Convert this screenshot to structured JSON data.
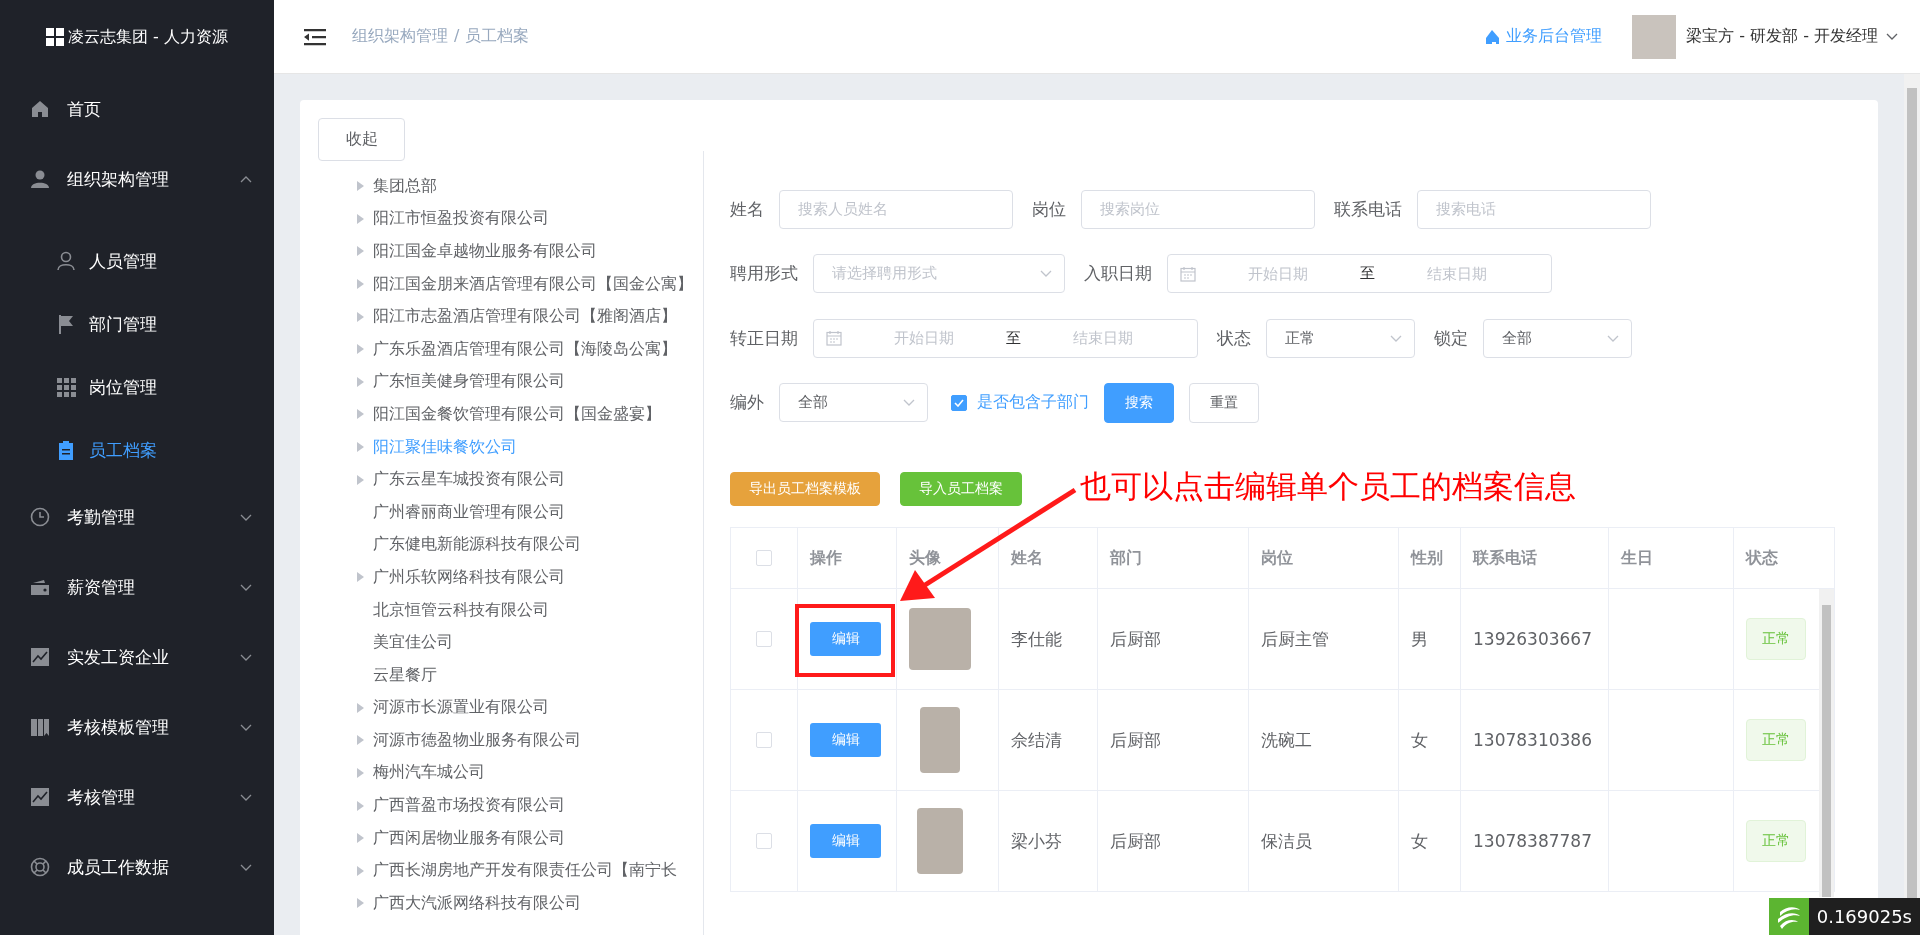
{
  "app": {
    "logo_title": "凌云志集团 - 人力资源"
  },
  "sidebar": {
    "items": [
      {
        "label": "首页"
      },
      {
        "label": "组织架构管理",
        "expanded": true,
        "children": [
          {
            "label": "人员管理",
            "selected": false
          },
          {
            "label": "部门管理",
            "selected": false
          },
          {
            "label": "岗位管理",
            "selected": false
          },
          {
            "label": "员工档案",
            "selected": true
          }
        ]
      },
      {
        "label": "考勤管理",
        "expanded": false
      },
      {
        "label": "薪资管理",
        "expanded": false
      },
      {
        "label": "实发工资企业",
        "expanded": false
      },
      {
        "label": "考核模板管理",
        "expanded": false
      },
      {
        "label": "考核管理",
        "expanded": false
      },
      {
        "label": "成员工作数据",
        "expanded": false
      }
    ]
  },
  "header": {
    "breadcrumb": [
      "组织架构管理",
      "员工档案"
    ],
    "breadcrumb_separator": "/",
    "home_link": "业务后台管理",
    "user": "梁宝方 - 研发部 - 开发经理"
  },
  "tree": {
    "collapse_button": "收起",
    "items": [
      {
        "label": "集团总部",
        "has_children": true,
        "selected": false
      },
      {
        "label": "阳江市恒盈投资有限公司",
        "has_children": true,
        "selected": false
      },
      {
        "label": "阳江国金卓越物业服务有限公司",
        "has_children": true,
        "selected": false
      },
      {
        "label": "阳江国金朋来酒店管理有限公司【国金公寓】",
        "has_children": true,
        "selected": false
      },
      {
        "label": "阳江市志盈酒店管理有限公司【雅阁酒店】",
        "has_children": true,
        "selected": false
      },
      {
        "label": "广东乐盈酒店管理有限公司【海陵岛公寓】",
        "has_children": true,
        "selected": false
      },
      {
        "label": "广东恒美健身管理有限公司",
        "has_children": true,
        "selected": false
      },
      {
        "label": "阳江国金餐饮管理有限公司【国金盛宴】",
        "has_children": true,
        "selected": false
      },
      {
        "label": "阳江聚佳味餐饮公司",
        "has_children": true,
        "selected": true
      },
      {
        "label": "广东云星车城投资有限公司",
        "has_children": true,
        "selected": false
      },
      {
        "label": "广州睿丽商业管理有限公司",
        "has_children": false,
        "selected": false
      },
      {
        "label": "广东健电新能源科技有限公司",
        "has_children": false,
        "selected": false
      },
      {
        "label": "广州乐软网络科技有限公司",
        "has_children": true,
        "selected": false
      },
      {
        "label": "北京恒管云科技有限公司",
        "has_children": false,
        "selected": false
      },
      {
        "label": "美宜佳公司",
        "has_children": false,
        "selected": false
      },
      {
        "label": "云星餐厅",
        "has_children": false,
        "selected": false
      },
      {
        "label": "河源市长源置业有限公司",
        "has_children": true,
        "selected": false
      },
      {
        "label": "河源市德盈物业服务有限公司",
        "has_children": true,
        "selected": false
      },
      {
        "label": "梅州汽车城公司",
        "has_children": true,
        "selected": false
      },
      {
        "label": "广西普盈市场投资有限公司",
        "has_children": true,
        "selected": false
      },
      {
        "label": "广西闲居物业服务有限公司",
        "has_children": true,
        "selected": false
      },
      {
        "label": "广西长湖房地产开发有限责任公司【南宁长",
        "has_children": true,
        "selected": false
      },
      {
        "label": "广西大汽派网络科技有限公司",
        "has_children": true,
        "selected": false
      }
    ]
  },
  "filters": {
    "rows": [
      {
        "fields": [
          {
            "kind": "text",
            "label": "姓名",
            "placeholder": "搜索人员姓名"
          },
          {
            "kind": "text",
            "label": "岗位",
            "placeholder": "搜索岗位"
          },
          {
            "kind": "text",
            "label": "联系电话",
            "placeholder": "搜索电话"
          }
        ]
      },
      {
        "fields": [
          {
            "kind": "select",
            "label": "聘用形式",
            "placeholder": "请选择聘用形式"
          },
          {
            "kind": "daterange",
            "label": "入职日期",
            "start_placeholder": "开始日期",
            "separator": "至",
            "end_placeholder": "结束日期"
          }
        ]
      },
      {
        "fields": [
          {
            "kind": "daterange",
            "label": "转正日期",
            "start_placeholder": "开始日期",
            "separator": "至",
            "end_placeholder": "结束日期"
          },
          {
            "kind": "select",
            "label": "状态",
            "value": "正常"
          },
          {
            "kind": "select",
            "label": "锁定",
            "value": "全部"
          }
        ]
      },
      {
        "fields": [
          {
            "kind": "select",
            "label": "编外",
            "value": "全部"
          },
          {
            "kind": "checkbox",
            "label": "是否包含子部门",
            "checked": true
          },
          {
            "kind": "primary",
            "label": "搜索"
          },
          {
            "kind": "default",
            "label": "重置"
          }
        ]
      }
    ]
  },
  "actions": [
    {
      "kind": "warning",
      "label": "导出员工档案模板"
    },
    {
      "kind": "success",
      "label": "导入员工档案"
    }
  ],
  "annotation": {
    "text": "也可以点击编辑单个员工的档案信息"
  },
  "table": {
    "select_all_checked": false,
    "columns": [
      "操作",
      "头像",
      "姓名",
      "部门",
      "岗位",
      "性别",
      "联系电话",
      "生日",
      "状态"
    ],
    "rows": [
      {
        "checked": false,
        "action": "编辑",
        "name": "李仕能",
        "department": "后厨部",
        "position": "后厨主管",
        "gender": "男",
        "phone": "13926303667",
        "status": "正常"
      },
      {
        "checked": false,
        "action": "编辑",
        "name": "佘结清",
        "department": "后厨部",
        "position": "洗碗工",
        "gender": "女",
        "phone": "13078310386",
        "status": "正常"
      },
      {
        "checked": false,
        "action": "编辑",
        "name": "梁小芬",
        "department": "后厨部",
        "position": "保洁员",
        "gender": "女",
        "phone": "13078387787",
        "status": "正常"
      }
    ]
  },
  "timer": {
    "text": "0.169025s"
  }
}
